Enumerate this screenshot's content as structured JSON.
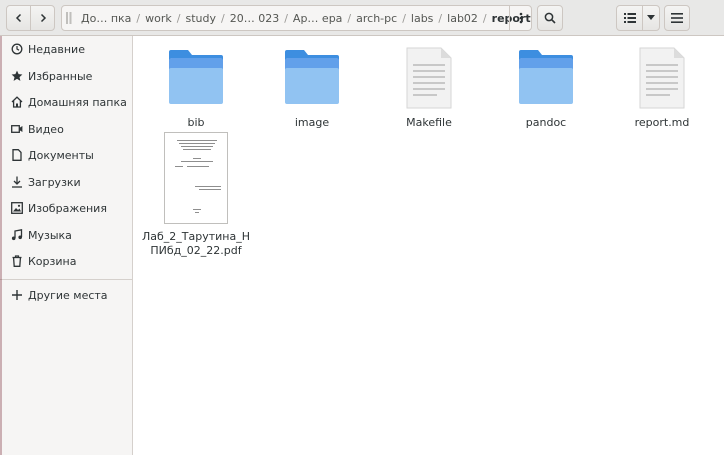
{
  "pathbar": {
    "crumbs": [
      "До… пка",
      "work",
      "study",
      "20… 023",
      "Ар… ера",
      "arch-pc",
      "labs",
      "lab02",
      "report"
    ]
  },
  "sidebar": {
    "items": [
      {
        "label": "Недавние",
        "icon": "clock-icon"
      },
      {
        "label": "Избранные",
        "icon": "star-icon"
      },
      {
        "label": "Домашняя папка",
        "icon": "home-icon"
      },
      {
        "label": "Видео",
        "icon": "video-icon"
      },
      {
        "label": "Документы",
        "icon": "document-icon"
      },
      {
        "label": "Загрузки",
        "icon": "download-icon"
      },
      {
        "label": "Изображения",
        "icon": "image-icon"
      },
      {
        "label": "Музыка",
        "icon": "music-icon"
      },
      {
        "label": "Корзина",
        "icon": "trash-icon"
      },
      {
        "label": "Другие места",
        "icon": "plus-icon"
      }
    ]
  },
  "files": [
    {
      "name": "bib",
      "type": "folder"
    },
    {
      "name": "image",
      "type": "folder"
    },
    {
      "name": "Makefile",
      "type": "text"
    },
    {
      "name": "pandoc",
      "type": "folder"
    },
    {
      "name": "report.md",
      "type": "text"
    },
    {
      "name": "Лаб_2_Тарутина_НПИбд_02_22.pdf",
      "type": "pdf"
    }
  ],
  "colors": {
    "folder_top": "#62a0ea",
    "folder_body": "#8fc1f0",
    "accent": "#3584e4"
  }
}
